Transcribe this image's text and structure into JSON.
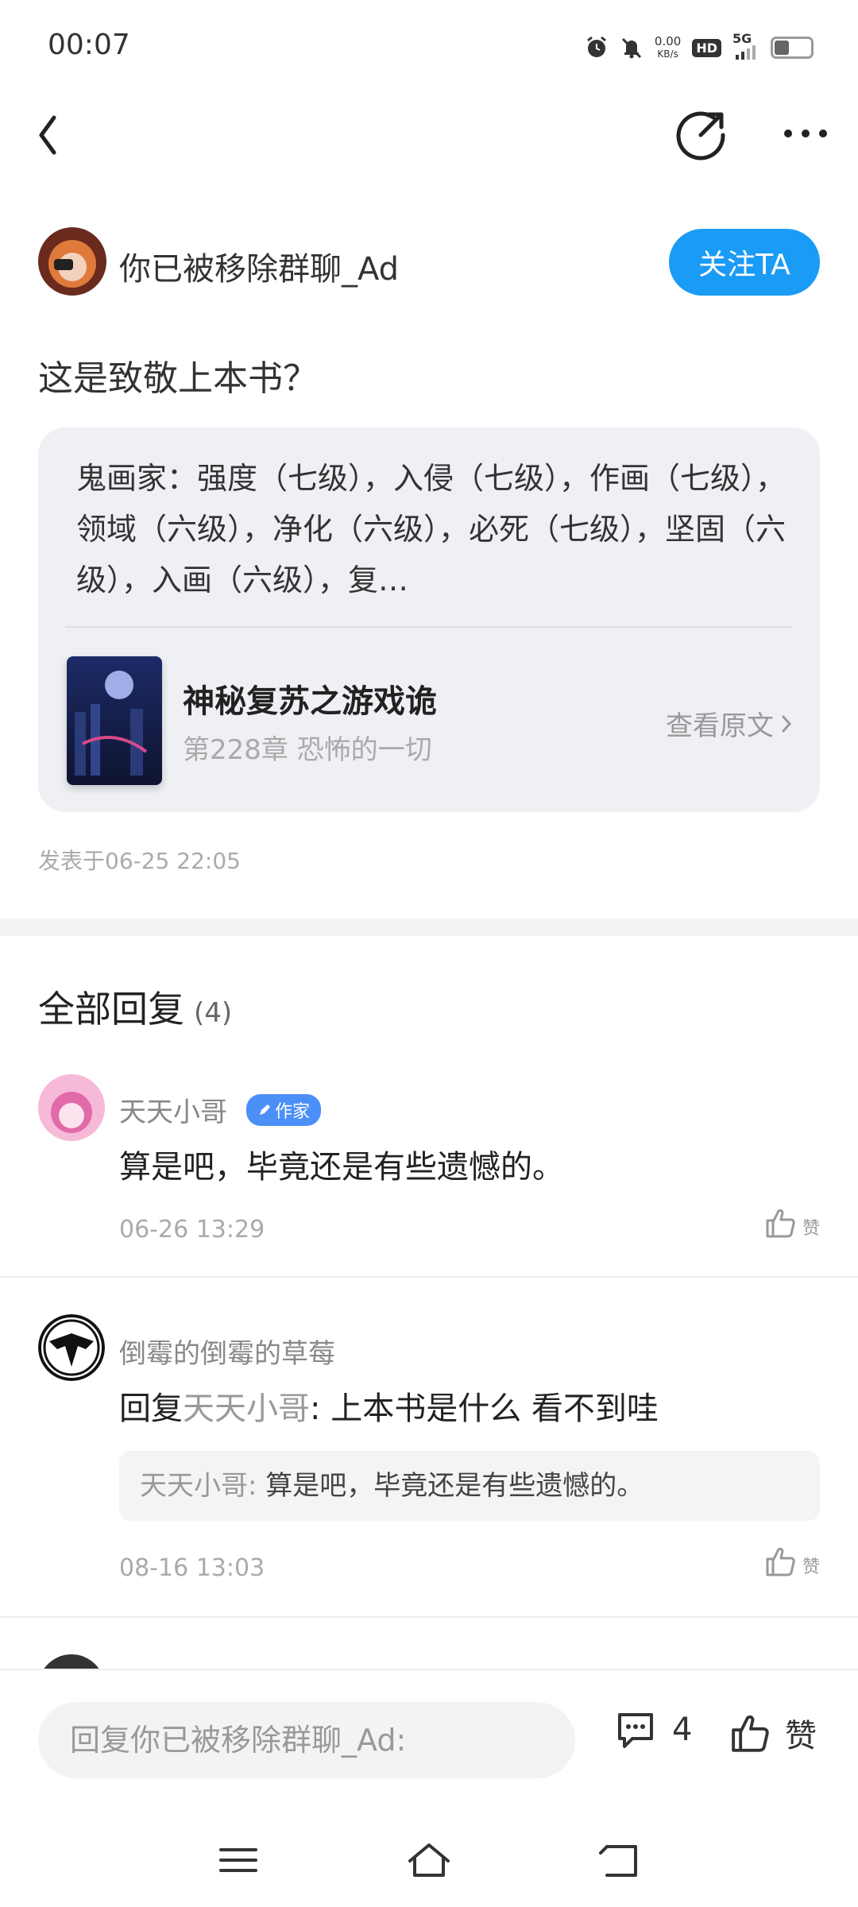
{
  "status_bar": {
    "time": "00:07",
    "net_speed_value": "0.00",
    "net_speed_unit": "KB/s",
    "hd_label": "HD",
    "network_label": "5G",
    "battery_percent": 40
  },
  "author": {
    "name": "你已被移除群聊_Ad",
    "follow_label": "关注TA"
  },
  "post": {
    "title": "这是致敬上本书？",
    "quote": "鬼画家：强度（七级），入侵（七级），作画（七级），领域（六级），净化（六级），必死（七级），坚固（六级），入画（六级），复…",
    "book_title": "神秘复苏之游戏诡",
    "book_chapter": "第228章 恐怖的一切",
    "view_original_label": "查看原文",
    "posted_time": "发表于06-25 22:05"
  },
  "replies": {
    "header": "全部回复",
    "count": "(4)",
    "items": [
      {
        "user": "天天小哥",
        "badge": "作家",
        "text": "算是吧，毕竟还是有些遗憾的。",
        "date": "06-26 13:29",
        "like_label": "赞"
      },
      {
        "user": "倒霉的倒霉的草莓",
        "reply_prefix": "回复",
        "reply_target": "天天小哥",
        "text": ": 上本书是什么 看不到哇",
        "quoted_user": "天天小哥:",
        "quoted_text": " 算是吧，毕竟还是有些遗憾的。",
        "date": "08-16 13:03",
        "like_label": "赞"
      }
    ]
  },
  "bottom_bar": {
    "reply_placeholder": "回复你已被移除群聊_Ad:",
    "comment_count": "4",
    "like_label": "赞"
  },
  "colors": {
    "accent": "#1a9bf5",
    "author_badge": "#4c8ff7"
  }
}
